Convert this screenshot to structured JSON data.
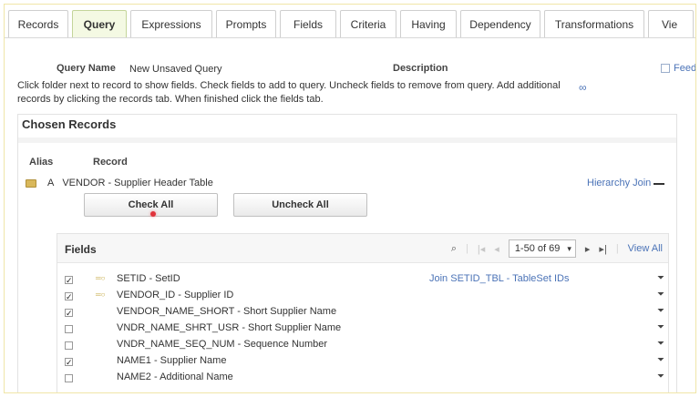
{
  "tabs": [
    {
      "label": "Records",
      "active": false
    },
    {
      "label": "Query",
      "active": true
    },
    {
      "label": "Expressions",
      "active": false
    },
    {
      "label": "Prompts",
      "active": false
    },
    {
      "label": "Fields",
      "active": false
    },
    {
      "label": "Criteria",
      "active": false
    },
    {
      "label": "Having",
      "active": false
    },
    {
      "label": "Dependency",
      "active": false
    },
    {
      "label": "Transformations",
      "active": false
    },
    {
      "label": "Vie",
      "active": false
    }
  ],
  "query": {
    "name_label": "Query Name",
    "name_value": "New Unsaved Query",
    "description_label": "Description",
    "feedback_label": "Feed",
    "instructions": "Click folder next to record to show fields. Check fields to add to query. Uncheck fields to remove from query. Add additional records by clicking the records tab. When finished click the fields tab."
  },
  "chosen_records": {
    "title": "Chosen Records",
    "alias_header": "Alias",
    "record_header": "Record",
    "record": {
      "alias": "A",
      "name": "VENDOR - Supplier Header Table",
      "hierarchy_join": "Hierarchy Join"
    },
    "check_all": "Check All",
    "uncheck_all": "Uncheck All"
  },
  "fields": {
    "title": "Fields",
    "pager": {
      "range": "1-50 of 69",
      "view_all": "View All"
    },
    "rows": [
      {
        "checked": true,
        "key": true,
        "name": "SETID - SetID",
        "join": "Join SETID_TBL - TableSet IDs"
      },
      {
        "checked": true,
        "key": true,
        "name": "VENDOR_ID - Supplier ID",
        "join": ""
      },
      {
        "checked": true,
        "key": false,
        "name": "VENDOR_NAME_SHORT - Short Supplier Name",
        "join": ""
      },
      {
        "checked": false,
        "key": false,
        "name": "VNDR_NAME_SHRT_USR - Short Supplier Name",
        "join": ""
      },
      {
        "checked": false,
        "key": false,
        "name": "VNDR_NAME_SEQ_NUM - Sequence Number",
        "join": ""
      },
      {
        "checked": true,
        "key": false,
        "name": "NAME1 - Supplier Name",
        "join": ""
      },
      {
        "checked": false,
        "key": false,
        "name": "NAME2 - Additional Name",
        "join": ""
      }
    ]
  },
  "icons": {
    "folder": "folder-icon",
    "key": "key-icon",
    "funnel": "funnel-icon",
    "search": "search-icon"
  },
  "colors": {
    "active_tab_bg": "#f4f9e3",
    "link": "#4b73b7",
    "click_indicator": "#e0343c"
  }
}
